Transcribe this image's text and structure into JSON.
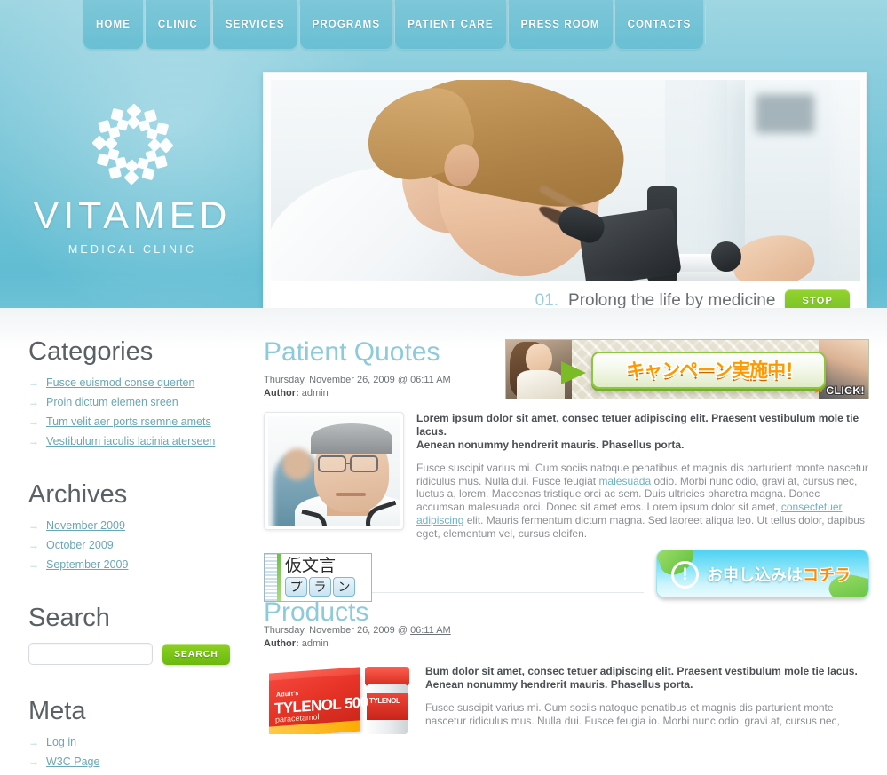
{
  "nav": {
    "items": [
      {
        "label": "HOME"
      },
      {
        "label": "CLINIC"
      },
      {
        "label": "SERVICES"
      },
      {
        "label": "PROGRAMS"
      },
      {
        "label": "PATIENT CARE"
      },
      {
        "label": "PRESS ROOM"
      },
      {
        "label": "CONTACTS"
      }
    ]
  },
  "logo": {
    "title": "VITAMED",
    "subtitle": "MEDICAL CLINIC",
    "mark_icon": "flower-rosette-icon"
  },
  "slider": {
    "slide_number": "01.",
    "caption": "Prolong the life by medicine",
    "stop_label": "STOP",
    "photo_alt": "female-scientist-microscope-photo"
  },
  "sidebar": {
    "categories": {
      "heading": "Categories",
      "items": [
        {
          "label": "Fusce euismod conse querten"
        },
        {
          "label": "Proin dictum elemen sreen"
        },
        {
          "label": "Tum velit aer ports rsemne amets"
        },
        {
          "label": "Vestibulum iaculis lacinia aterseen"
        }
      ]
    },
    "archives": {
      "heading": "Archives",
      "items": [
        {
          "label": "November 2009"
        },
        {
          "label": "October 2009"
        },
        {
          "label": "September 2009"
        }
      ]
    },
    "search": {
      "heading": "Search",
      "value": "",
      "placeholder": "",
      "button_label": "SEARCH"
    },
    "meta": {
      "heading": "Meta",
      "items": [
        {
          "label": "Log in"
        },
        {
          "label": "W3C Page"
        }
      ]
    },
    "bullet_icon": "arrow-right-icon"
  },
  "banner_top": {
    "jp_text": "キャンペーン実施中!",
    "click_label": "CLICK!",
    "arrow_icon": "triangle-right-icon"
  },
  "banner_apply": {
    "jp_text_plain": "お申し込みは",
    "jp_text_accent": "コチラ",
    "icon": "exclamation-circle-icon"
  },
  "jp_box": {
    "big": "仮文言",
    "chips": [
      "プ",
      "ラ",
      "ン"
    ]
  },
  "posts": [
    {
      "title": "Patient Quotes",
      "date": "Thursday, November 26, 2009 @",
      "time": "06:11 AM",
      "author_label": "Author:",
      "author": "admin",
      "thumb_alt": "senior-doctor-portrait-photo",
      "lead": "Lorem ipsum dolor sit amet, consec tetuer adipiscing elit. Praesent vestibulum mole tie lacus.\nAenean nonummy hendrerit mauris. Phasellus porta.",
      "body_1": "Fusce suscipit varius mi. Cum sociis natoque penatibus et magnis dis parturient monte nascetur ridiculus mus. Nulla dui. Fusce feugiat ",
      "link_1": "malesuada",
      "body_2": " odio. Morbi nunc odio, gravi at, cursus nec, luctus a, lorem. Maecenas tristique orci ac sem. Duis ultricies pharetra magna. Donec accumsan malesuada orci. Donec sit amet eros. Lorem ipsum dolor sit amet, ",
      "link_2": "consectetuer adipiscing",
      "body_3": " elit. Mauris fermentum dictum magna. Sed laoreet aliqua leo. Ut tellus dolor, dapibus eget, elementum vel, cursus eleifen."
    },
    {
      "title": "Products",
      "date": "Thursday, November 26, 2009 @",
      "time": "06:11 AM",
      "author_label": "Author:",
      "author": "admin",
      "thumb_alt": "tylenol-500-paracetamol-box-photo",
      "product_brand_small": "Adult's",
      "product_brand": "TYLENOL",
      "product_strength": "500",
      "product_generic": "paracetamol",
      "lead": "Bum dolor sit amet, consec tetuer adipiscing elit. Praesent vestibulum mole tie lacus.\nAenean nonummy hendrerit mauris. Phasellus porta.",
      "body_1": "Fusce suscipit varius mi. Cum sociis natoque penatibus et magnis dis parturient monte nascetur ridiculus mus. Nulla dui. Fusce feugia io. Morbi nunc odio, gravi at, cursus nec,"
    }
  ],
  "colors": {
    "header_teal": "#72c3d6",
    "accent_green": "#79c417",
    "title_blue": "#8dcada",
    "link_teal": "#6aa7b5",
    "body_gray": "#8a9093"
  }
}
